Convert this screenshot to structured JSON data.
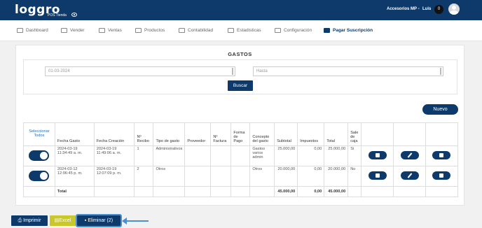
{
  "header": {
    "logo": "loggro",
    "logo_sub": "POS Tienda",
    "store": "Accesorios MP -",
    "user": "Luis",
    "notifications": "0"
  },
  "nav": [
    {
      "label": "Dashboard",
      "icon": "dashboard-icon"
    },
    {
      "label": "Vender",
      "icon": "cart-icon"
    },
    {
      "label": "Ventas",
      "icon": "money-icon"
    },
    {
      "label": "Productos",
      "icon": "box-icon"
    },
    {
      "label": "Contabilidad",
      "icon": "book-icon"
    },
    {
      "label": "Estadisticas",
      "icon": "bar-chart-icon"
    },
    {
      "label": "Configuración",
      "icon": "gear-icon"
    },
    {
      "label": "Pagar Suscripción",
      "icon": "card-icon",
      "active": true
    }
  ],
  "page": {
    "title": "GASTOS",
    "date_from": "01-03-2024",
    "date_to_placeholder": "Hasta",
    "search_label": "Buscar",
    "new_label": "Nuevo"
  },
  "table": {
    "headers": [
      "Seleccionar Todos",
      "Fecha Gasto",
      "Fecha Creación",
      "Nº Recibo",
      "Tipo de gasto",
      "Proveedor",
      "Nº Factura",
      "Forma de Pago",
      "Concepto del gasto",
      "Subtotal",
      "Impuestos",
      "Total",
      "Sale de caja"
    ],
    "rows": [
      {
        "fecha_gasto": "2024-03-19 11:34:49 a. m.",
        "fecha_creacion": "2024-03-19 11:49:06 a. m.",
        "recibo": "1",
        "tipo": "Administrativos",
        "proveedor": "",
        "factura": "",
        "forma_pago": "",
        "concepto": "Gastos varios admin",
        "subtotal": "25.000,00",
        "impuestos": "0,00",
        "total": "25.000,00",
        "sale_caja": "Si"
      },
      {
        "fecha_gasto": "2024-03-12 12:06:45 p. m.",
        "fecha_creacion": "2024-03-19 12:07:09 p. m.",
        "recibo": "2",
        "tipo": "Otros",
        "proveedor": "",
        "factura": "",
        "forma_pago": "",
        "concepto": "Otros",
        "subtotal": "20.000,00",
        "impuestos": "0,00",
        "total": "20.000,00",
        "sale_caja": "No"
      }
    ],
    "total_label": "Total",
    "total_subtotal": "45.000,00",
    "total_impuestos": "0,00",
    "total_total": "45.000,00"
  },
  "actions": {
    "print": "Imprimir",
    "excel": "Excel",
    "delete": "Eliminar (2)"
  },
  "colors": {
    "primary": "#0d3a6b",
    "excel": "#c8c82a",
    "highlight": "#4a8fd0"
  }
}
